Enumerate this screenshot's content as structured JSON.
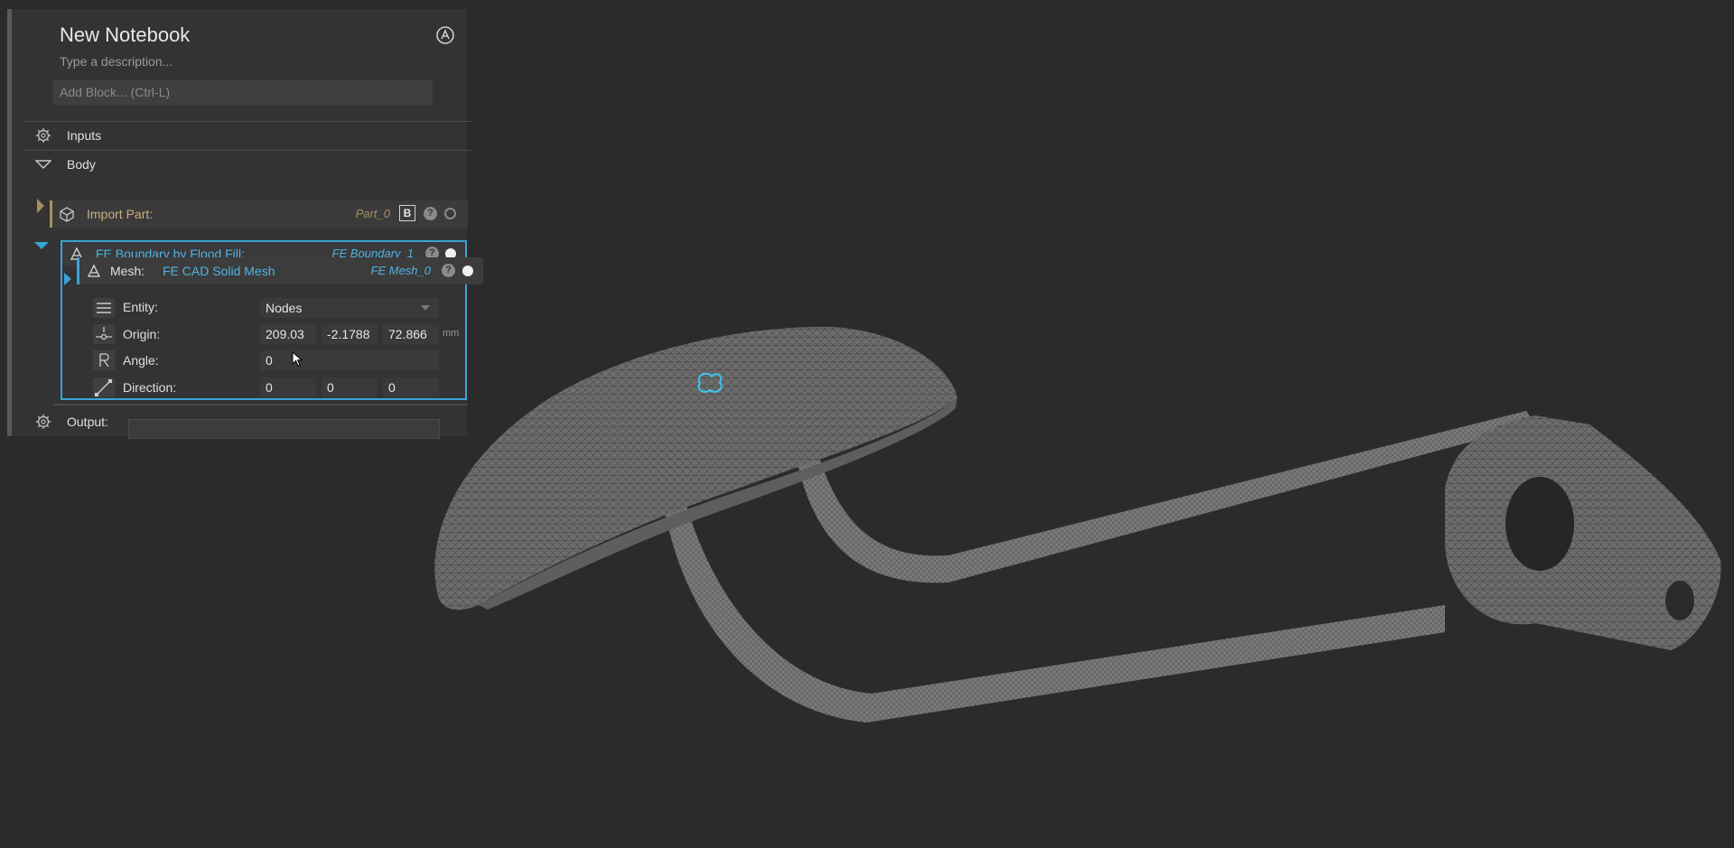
{
  "notebook": {
    "title": "New Notebook",
    "description_placeholder": "Type a description...",
    "add_block_placeholder": "Add Block... (Ctrl-L)"
  },
  "sections": {
    "inputs_label": "Inputs",
    "body_label": "Body",
    "output_label": "Output:"
  },
  "import_block": {
    "label": "Import Part:",
    "variable": "Part_0",
    "badge": "B",
    "help": "?"
  },
  "fe_block": {
    "label": "FE Boundary by Flood Fill:",
    "variable": "FE Boundary_1",
    "help": "?"
  },
  "mesh_row": {
    "label": "Mesh:",
    "value": "FE CAD Solid Mesh",
    "variable": "FE Mesh_0",
    "help": "?"
  },
  "entity_row": {
    "label": "Entity:",
    "value": "Nodes"
  },
  "origin_row": {
    "label": "Origin:",
    "x": "209.03",
    "y": "-2.1788",
    "z": "72.866",
    "unit": "mm"
  },
  "angle_row": {
    "label": "Angle:",
    "value": "0"
  },
  "direction_row": {
    "label": "Direction:",
    "x": "0",
    "y": "0",
    "z": "0"
  },
  "colors": {
    "accent": "#3aa3d6",
    "import_accent": "#a89060",
    "background": "#2b2b2b",
    "panel": "#333333"
  },
  "icons": [
    "refresh-icon",
    "gear-icon",
    "triangle-down-icon",
    "import-part-icon",
    "fe-boundary-icon",
    "mesh-icon",
    "list-icon",
    "origin-icon",
    "angle-icon",
    "direction-icon",
    "dropdown-chevron-icon",
    "cursor-icon"
  ]
}
